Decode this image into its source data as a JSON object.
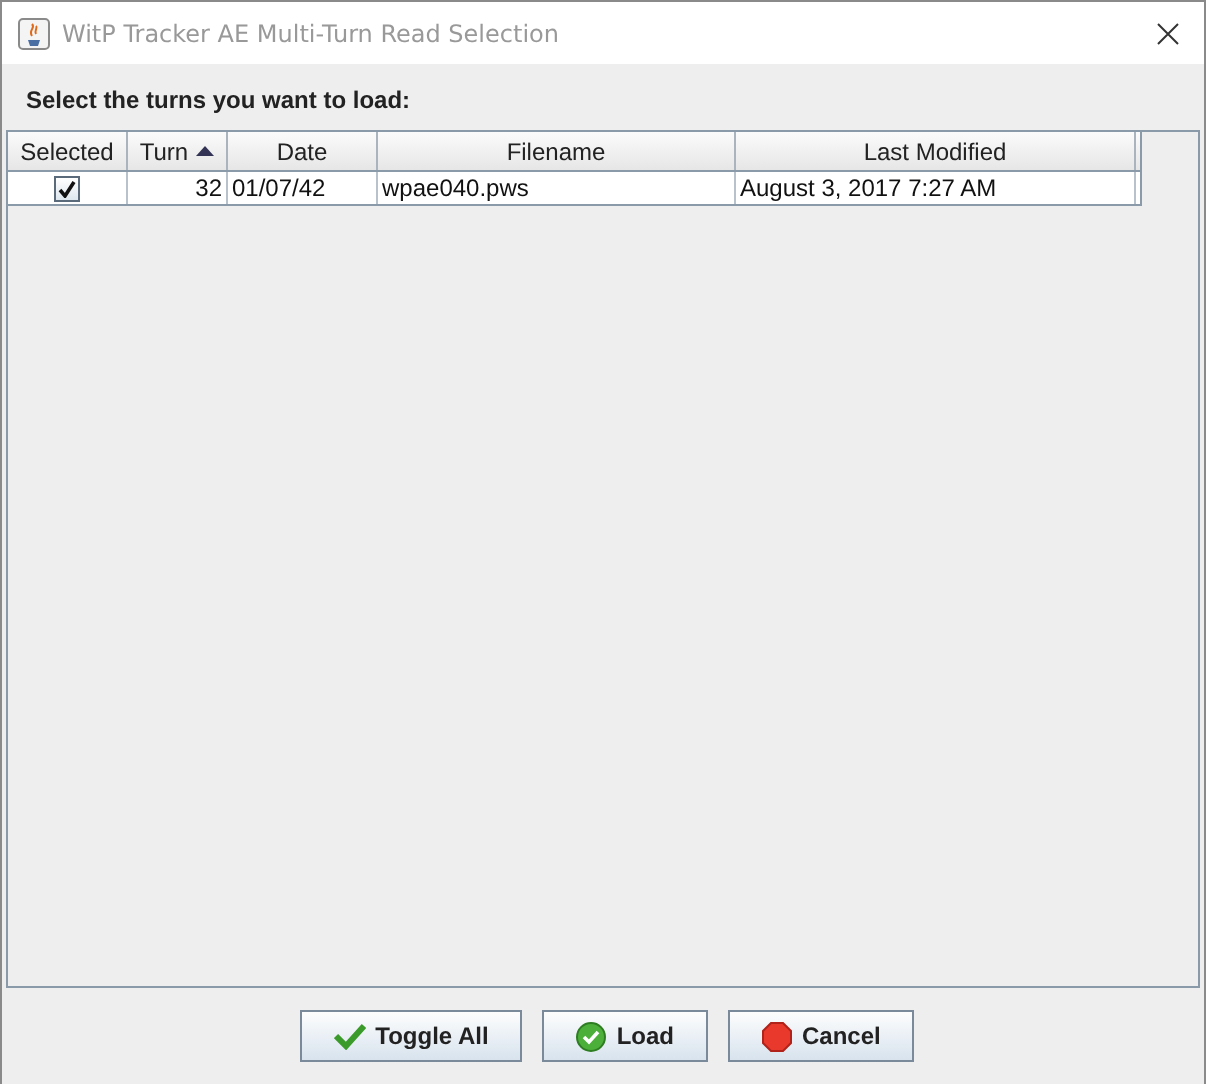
{
  "window": {
    "title": "WitP Tracker AE Multi-Turn Read Selection"
  },
  "instruction": "Select the turns you want to load:",
  "table": {
    "columns": [
      {
        "label": "Selected",
        "sorted": false
      },
      {
        "label": "Turn",
        "sorted": true
      },
      {
        "label": "Date",
        "sorted": false
      },
      {
        "label": "Filename",
        "sorted": false
      },
      {
        "label": "Last Modified",
        "sorted": false
      }
    ],
    "rows": [
      {
        "checked": true,
        "turn": "32",
        "date": "01/07/42",
        "filename": "wpae040.pws",
        "modified": "August 3, 2017 7:27 AM"
      }
    ]
  },
  "buttons": [
    {
      "label": "Toggle All",
      "kind": "check"
    },
    {
      "label": "Load",
      "kind": "ok"
    },
    {
      "label": "Cancel",
      "kind": "stop"
    }
  ]
}
